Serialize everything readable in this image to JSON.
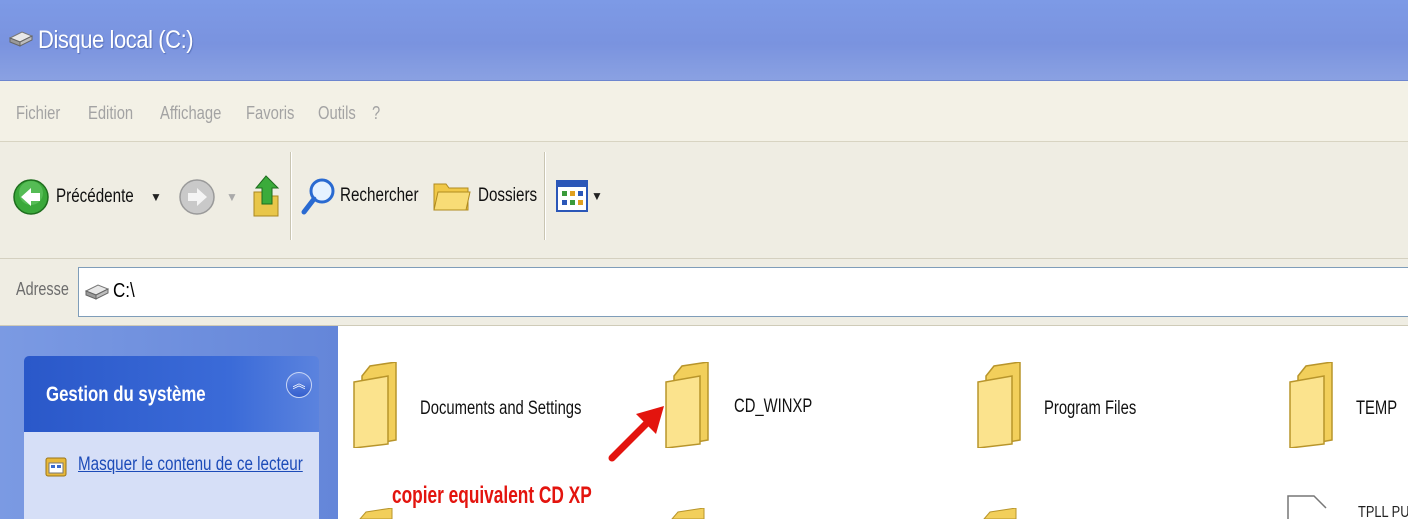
{
  "window": {
    "title": "Disque local (C:)"
  },
  "menu": {
    "items": [
      "Fichier",
      "Edition",
      "Affichage",
      "Favoris",
      "Outils",
      "?"
    ]
  },
  "toolbar": {
    "back_label": "Précédente",
    "search_label": "Rechercher",
    "folders_label": "Dossiers"
  },
  "address": {
    "label": "Adresse",
    "value": "C:\\"
  },
  "sidebar": {
    "panel_title": "Gestion du système",
    "task_link": "Masquer le contenu de ce lecteur"
  },
  "files": [
    "Documents and Settings",
    "CD_WINXP",
    "Program Files",
    "TEMP"
  ],
  "partial_file_label": "TPLL PU",
  "annotation": "copier equivalent CD XP",
  "colors": {
    "titlebar": "#7d9ae6",
    "panel_header": "#2a58c9",
    "annotation": "#e3140e"
  }
}
